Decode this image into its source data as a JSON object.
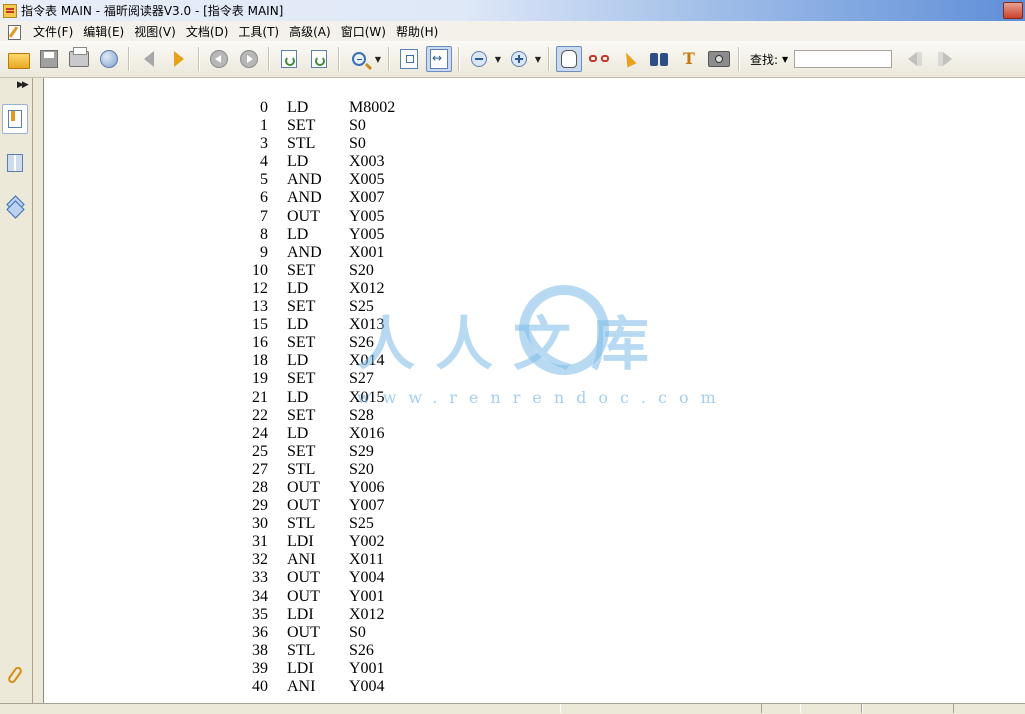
{
  "window": {
    "title": "指令表 MAIN - 福昕阅读器V3.0 - [指令表 MAIN]"
  },
  "menu": {
    "items": [
      "文件(F)",
      "编辑(E)",
      "视图(V)",
      "文档(D)",
      "工具(T)",
      "高级(A)",
      "窗口(W)",
      "帮助(H)"
    ]
  },
  "toolbar": {
    "search_label": "查找:",
    "search_value": "",
    "icons": [
      "open-folder-icon",
      "save-icon",
      "print-icon",
      "globe-icon",
      "previous-page-icon",
      "next-page-icon",
      "back-icon",
      "forward-icon",
      "rotate-left-icon",
      "rotate-right-icon",
      "zoom-icon",
      "fit-page-icon",
      "fit-width-icon",
      "zoom-out-icon",
      "zoom-in-icon",
      "hand-tool-icon",
      "reading-glasses-icon",
      "select-arrow-icon",
      "binoculars-icon",
      "text-select-icon",
      "snapshot-camera-icon",
      "find-previous-icon",
      "find-next-icon"
    ]
  },
  "left_panel": {
    "icons": [
      "bookmark-icon",
      "thumbnails-icon",
      "layers-icon",
      "attachment-clip-icon"
    ]
  },
  "document": {
    "instructions": [
      {
        "step": "0",
        "op": "LD",
        "arg": "M8002"
      },
      {
        "step": "1",
        "op": "SET",
        "arg": "S0"
      },
      {
        "step": "3",
        "op": "STL",
        "arg": "S0"
      },
      {
        "step": "4",
        "op": "LD",
        "arg": "X003"
      },
      {
        "step": "5",
        "op": "AND",
        "arg": "X005"
      },
      {
        "step": "6",
        "op": "AND",
        "arg": "X007"
      },
      {
        "step": "7",
        "op": "OUT",
        "arg": "Y005"
      },
      {
        "step": "8",
        "op": "LD",
        "arg": "Y005"
      },
      {
        "step": "9",
        "op": "AND",
        "arg": "X001"
      },
      {
        "step": "10",
        "op": "SET",
        "arg": "S20"
      },
      {
        "step": "12",
        "op": "LD",
        "arg": "X012"
      },
      {
        "step": "13",
        "op": "SET",
        "arg": "S25"
      },
      {
        "step": "15",
        "op": "LD",
        "arg": "X013"
      },
      {
        "step": "16",
        "op": "SET",
        "arg": "S26"
      },
      {
        "step": "18",
        "op": "LD",
        "arg": "X014"
      },
      {
        "step": "19",
        "op": "SET",
        "arg": "S27"
      },
      {
        "step": "21",
        "op": "LD",
        "arg": "X015"
      },
      {
        "step": "22",
        "op": "SET",
        "arg": "S28"
      },
      {
        "step": "24",
        "op": "LD",
        "arg": "X016"
      },
      {
        "step": "25",
        "op": "SET",
        "arg": "S29"
      },
      {
        "step": "27",
        "op": "STL",
        "arg": "S20"
      },
      {
        "step": "28",
        "op": "OUT",
        "arg": "Y006"
      },
      {
        "step": "29",
        "op": "OUT",
        "arg": "Y007"
      },
      {
        "step": "30",
        "op": "STL",
        "arg": "S25"
      },
      {
        "step": "31",
        "op": "LDI",
        "arg": "Y002"
      },
      {
        "step": "32",
        "op": "ANI",
        "arg": "X011"
      },
      {
        "step": "33",
        "op": "OUT",
        "arg": "Y004"
      },
      {
        "step": "34",
        "op": "OUT",
        "arg": "Y001"
      },
      {
        "step": "35",
        "op": "LDI",
        "arg": "X012"
      },
      {
        "step": "36",
        "op": "OUT",
        "arg": "S0"
      },
      {
        "step": "38",
        "op": "STL",
        "arg": "S26"
      },
      {
        "step": "39",
        "op": "LDI",
        "arg": "Y001"
      },
      {
        "step": "40",
        "op": "ANI",
        "arg": "Y004"
      }
    ]
  },
  "watermark": {
    "text": "人人文库",
    "url": "www.renrendoc.com"
  },
  "colors": {
    "watermark": "#7cbbe7",
    "accent": "#e8a21a"
  }
}
